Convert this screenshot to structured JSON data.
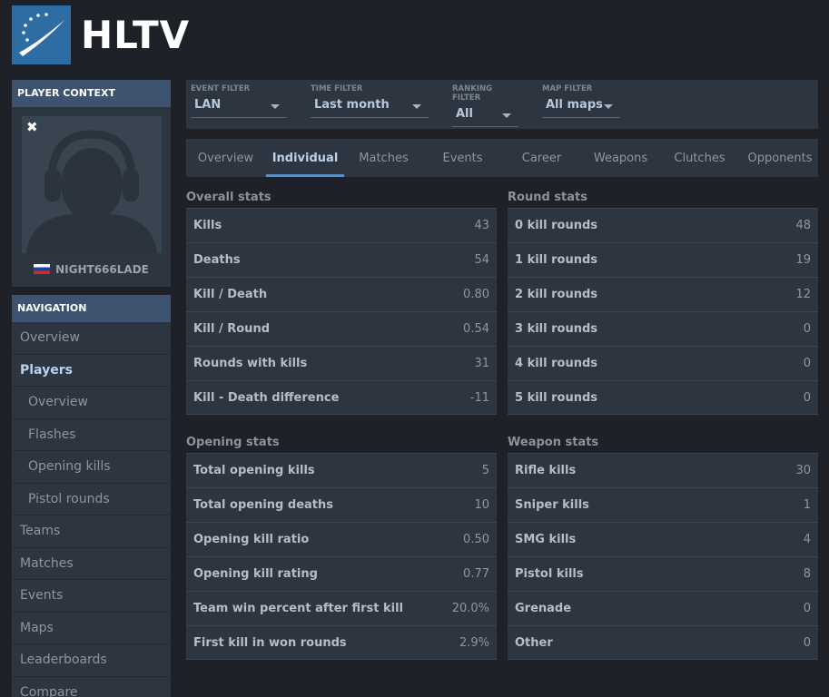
{
  "logo": {
    "text": "HLTV"
  },
  "player_context": {
    "header": "PLAYER CONTEXT",
    "name": "NIGHT666LADE",
    "close_symbol": "✖"
  },
  "navigation": {
    "header": "NAVIGATION",
    "items": [
      {
        "label": "Overview"
      },
      {
        "label": "Players"
      },
      {
        "label": "Overview"
      },
      {
        "label": "Flashes"
      },
      {
        "label": "Opening kills"
      },
      {
        "label": "Pistol rounds"
      },
      {
        "label": "Teams"
      },
      {
        "label": "Matches"
      },
      {
        "label": "Events"
      },
      {
        "label": "Maps"
      },
      {
        "label": "Leaderboards"
      },
      {
        "label": "Compare"
      }
    ]
  },
  "filters": [
    {
      "label": "EVENT FILTER",
      "value": "LAN"
    },
    {
      "label": "TIME FILTER",
      "value": "Last month"
    },
    {
      "label": "RANKING FILTER",
      "value": "All"
    },
    {
      "label": "MAP FILTER",
      "value": "All maps"
    }
  ],
  "tabs": [
    {
      "label": "Overview"
    },
    {
      "label": "Individual"
    },
    {
      "label": "Matches"
    },
    {
      "label": "Events"
    },
    {
      "label": "Career"
    },
    {
      "label": "Weapons"
    },
    {
      "label": "Clutches"
    },
    {
      "label": "Opponents"
    }
  ],
  "overall_stats": {
    "title": "Overall stats",
    "rows": [
      {
        "label": "Kills",
        "value": "43"
      },
      {
        "label": "Deaths",
        "value": "54"
      },
      {
        "label": "Kill / Death",
        "value": "0.80"
      },
      {
        "label": "Kill / Round",
        "value": "0.54"
      },
      {
        "label": "Rounds with kills",
        "value": "31"
      },
      {
        "label": "Kill - Death difference",
        "value": "-11"
      }
    ]
  },
  "round_stats": {
    "title": "Round stats",
    "rows": [
      {
        "label": "0 kill rounds",
        "value": "48"
      },
      {
        "label": "1 kill rounds",
        "value": "19"
      },
      {
        "label": "2 kill rounds",
        "value": "12"
      },
      {
        "label": "3 kill rounds",
        "value": "0"
      },
      {
        "label": "4 kill rounds",
        "value": "0"
      },
      {
        "label": "5 kill rounds",
        "value": "0"
      }
    ]
  },
  "opening_stats": {
    "title": "Opening stats",
    "rows": [
      {
        "label": "Total opening kills",
        "value": "5"
      },
      {
        "label": "Total opening deaths",
        "value": "10"
      },
      {
        "label": "Opening kill ratio",
        "value": "0.50"
      },
      {
        "label": "Opening kill rating",
        "value": "0.77"
      },
      {
        "label": "Team win percent after first kill",
        "value": "20.0%"
      },
      {
        "label": "First kill in won rounds",
        "value": "2.9%"
      }
    ]
  },
  "weapon_stats": {
    "title": "Weapon stats",
    "rows": [
      {
        "label": "Rifle kills",
        "value": "30"
      },
      {
        "label": "Sniper kills",
        "value": "1"
      },
      {
        "label": "SMG kills",
        "value": "4"
      },
      {
        "label": "Pistol kills",
        "value": "8"
      },
      {
        "label": "Grenade",
        "value": "0"
      },
      {
        "label": "Other",
        "value": "0"
      }
    ]
  }
}
